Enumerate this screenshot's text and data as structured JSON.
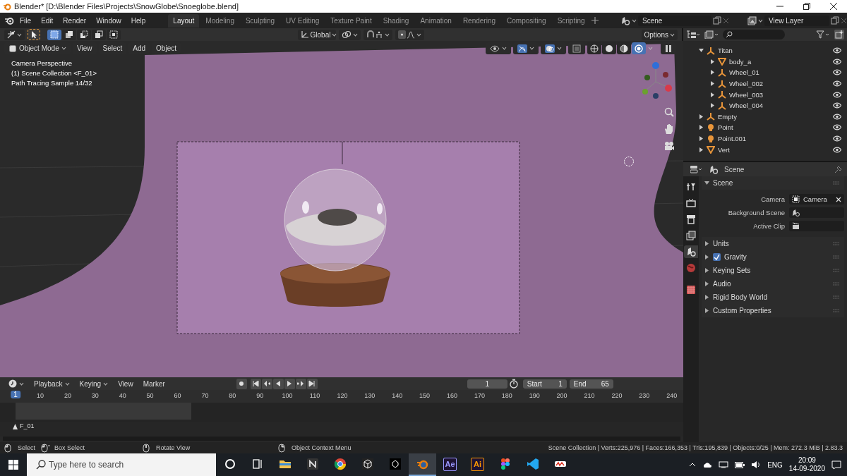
{
  "window": {
    "title": "Blender* [D:\\Blender Files\\Projects\\SnowGlobe\\Snoeglobe.blend]"
  },
  "menu": [
    "File",
    "Edit",
    "Render",
    "Window",
    "Help"
  ],
  "workspaces": [
    {
      "label": "Layout",
      "selected": true
    },
    {
      "label": "Modeling",
      "selected": false
    },
    {
      "label": "Sculpting",
      "selected": false
    },
    {
      "label": "UV Editing",
      "selected": false
    },
    {
      "label": "Texture Paint",
      "selected": false
    },
    {
      "label": "Shading",
      "selected": false
    },
    {
      "label": "Animation",
      "selected": false
    },
    {
      "label": "Rendering",
      "selected": false
    },
    {
      "label": "Compositing",
      "selected": false
    },
    {
      "label": "Scripting",
      "selected": false
    }
  ],
  "scene": "Scene",
  "view_layer": "View Layer",
  "viewport": {
    "select_modes": [
      {
        "kind": "new",
        "selected": true
      },
      {
        "kind": "extend",
        "selected": false
      },
      {
        "kind": "subtract",
        "selected": false
      },
      {
        "kind": "invert",
        "selected": false
      },
      {
        "kind": "intersect",
        "selected": false
      }
    ],
    "transform": "Global",
    "options": "Options",
    "mode": "Object Mode",
    "menus": [
      "View",
      "Select",
      "Add",
      "Object"
    ],
    "shading": [
      {
        "kind": "wireframe",
        "selected": false
      },
      {
        "kind": "solid",
        "selected": false
      },
      {
        "kind": "material",
        "selected": false
      },
      {
        "kind": "rendered",
        "selected": true
      }
    ],
    "overlay": [
      "Camera Perspective",
      "(1) Scene Collection <F_01>",
      "Path Tracing Sample 14/32"
    ]
  },
  "outliner": {
    "items": [
      {
        "name": "Titan",
        "kind": "empty",
        "expanded": true,
        "children": [
          {
            "name": "body_a",
            "kind": "mesh",
            "expanded": false
          },
          {
            "name": "Wheel_01",
            "kind": "empty",
            "expanded": false
          },
          {
            "name": "Wheel_002",
            "kind": "empty",
            "expanded": false
          },
          {
            "name": "Wheel_003",
            "kind": "empty",
            "expanded": false
          },
          {
            "name": "Wheel_004",
            "kind": "empty",
            "expanded": false
          }
        ]
      },
      {
        "name": "Empty",
        "kind": "empty",
        "expanded": false
      },
      {
        "name": "Point",
        "kind": "light",
        "expanded": false
      },
      {
        "name": "Point.001",
        "kind": "light",
        "expanded": false
      },
      {
        "name": "Vert",
        "kind": "mesh",
        "expanded": false
      }
    ]
  },
  "properties": {
    "context": "Scene",
    "tabs": [
      {
        "kind": "tool",
        "selected": false
      },
      {
        "kind": "render",
        "selected": false
      },
      {
        "kind": "output",
        "selected": false
      },
      {
        "kind": "view_layer",
        "selected": false
      },
      {
        "kind": "scene",
        "selected": true
      },
      {
        "kind": "world",
        "selected": false
      },
      {
        "kind": "texture",
        "selected": false
      }
    ],
    "panels": [
      {
        "kind": "panel",
        "label": "Scene",
        "expanded": true,
        "fields": [
          {
            "label": "Camera",
            "kind": "object",
            "value": "Camera"
          },
          {
            "label": "Background Scene",
            "kind": "scene"
          },
          {
            "label": "Active Clip",
            "kind": "clip"
          }
        ]
      },
      {
        "kind": "panel",
        "label": "Units",
        "expanded": false
      },
      {
        "kind": "checkbox",
        "label": "Gravity",
        "expanded": false,
        "checked": true
      },
      {
        "kind": "panel",
        "label": "Keying Sets",
        "expanded": false
      },
      {
        "kind": "panel",
        "label": "Audio",
        "expanded": false
      },
      {
        "kind": "panel",
        "label": "Rigid Body World",
        "expanded": false
      },
      {
        "kind": "panel",
        "label": "Custom Properties",
        "expanded": false
      }
    ]
  },
  "timeline": {
    "menus": [
      "Playback",
      "Keying",
      "View",
      "Marker"
    ],
    "current_frame": "1",
    "start_label": "Start",
    "start": "1",
    "end_label": "End",
    "end": "65",
    "ticks": [
      "1",
      "10",
      "20",
      "30",
      "40",
      "50",
      "60",
      "70",
      "80",
      "90",
      "100",
      "110",
      "120",
      "130",
      "140",
      "150",
      "160",
      "170",
      "180",
      "190",
      "200",
      "210",
      "220",
      "230",
      "240"
    ],
    "marker": "F_01"
  },
  "status_bar": {
    "hints": [
      {
        "kind": "left",
        "label": "Select"
      },
      {
        "kind": "drag",
        "label": "Box Select"
      },
      {
        "kind": "middle",
        "label": "Rotate View"
      },
      {
        "kind": "right",
        "label": "Object Context Menu"
      }
    ],
    "stats": "Scene Collection | Verts:225,976 | Faces:166,353 | Tris:195,839 | Objects:0/25 | Mem: 272.3 MiB | 2.83.3"
  },
  "taskbar": {
    "search": {
      "placeholder": "Type here to search"
    },
    "apps": [
      {
        "kind": "cortana",
        "selected": false
      },
      {
        "kind": "taskview",
        "selected": false
      },
      {
        "kind": "folder",
        "selected": false
      },
      {
        "kind": "notes",
        "selected": false
      },
      {
        "kind": "browser",
        "selected": false
      },
      {
        "kind": "cube",
        "selected": false
      },
      {
        "kind": "cube2",
        "selected": false
      },
      {
        "kind": "blender",
        "selected": true
      },
      {
        "kind": "tile",
        "label": "Ae",
        "color": "#9999ff",
        "selected": false
      },
      {
        "kind": "tile",
        "label": "Ai",
        "color": "#ff9a00",
        "selected": false
      },
      {
        "kind": "figma",
        "selected": false
      },
      {
        "kind": "code",
        "selected": false
      },
      {
        "kind": "logo",
        "selected": false
      }
    ],
    "language": "ENG",
    "time": "20:09",
    "date": "14-09-2020"
  }
}
